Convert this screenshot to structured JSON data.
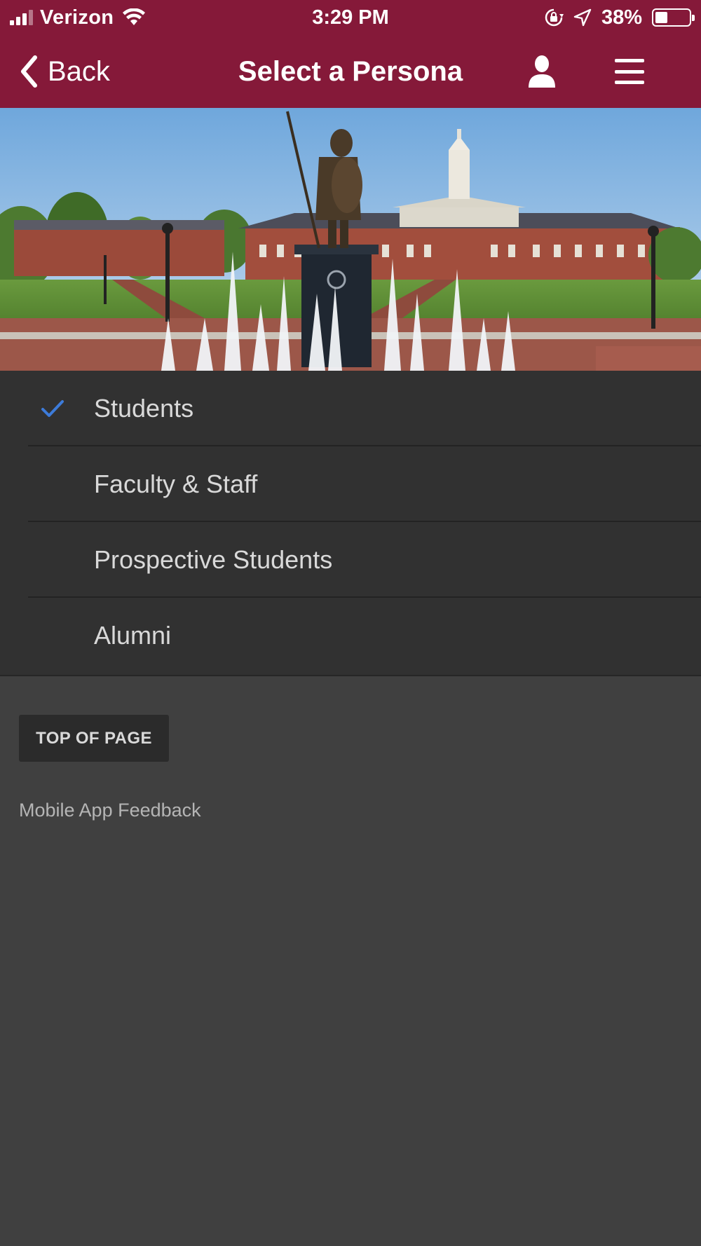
{
  "status_bar": {
    "carrier": "Verizon",
    "time": "3:29 PM",
    "battery_percent": "38%",
    "battery_level": 0.38,
    "icons": [
      "signal-icon",
      "wifi-icon",
      "rotation-lock-icon",
      "location-arrow-icon",
      "battery-icon"
    ]
  },
  "nav": {
    "back_label": "Back",
    "title": "Select a Persona",
    "icons": [
      "chevron-left-icon",
      "person-icon",
      "hamburger-menu-icon"
    ],
    "bar_color": "#851939"
  },
  "hero": {
    "image": "campus-photo"
  },
  "personas": {
    "items": [
      {
        "label": "Students",
        "selected": true
      },
      {
        "label": "Faculty & Staff",
        "selected": false
      },
      {
        "label": "Prospective Students",
        "selected": false
      },
      {
        "label": "Alumni",
        "selected": false
      }
    ],
    "check_color": "#3d7bd9"
  },
  "footer": {
    "top_button_label": "TOP OF PAGE",
    "feedback_label": "Mobile App Feedback"
  }
}
